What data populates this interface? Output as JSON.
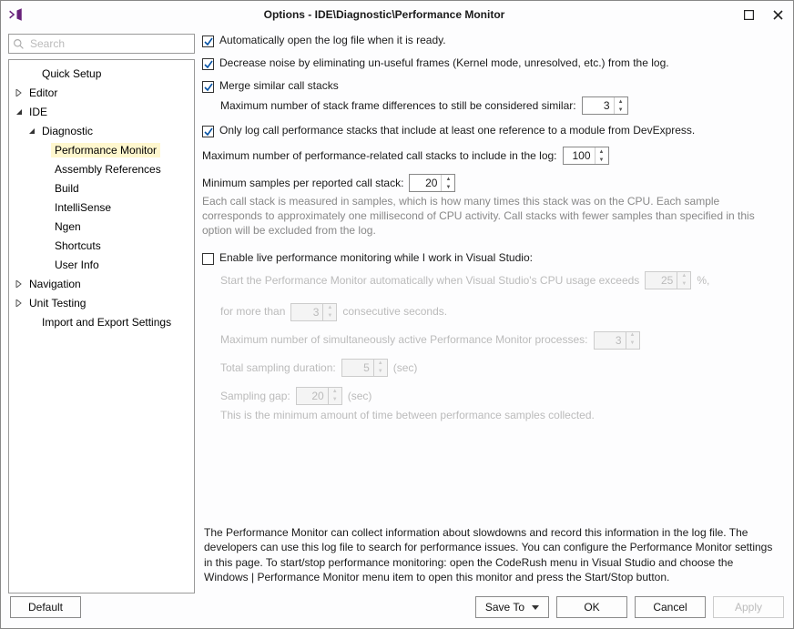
{
  "window": {
    "title": "Options - IDE\\Diagnostic\\Performance Monitor"
  },
  "search": {
    "placeholder": "Search"
  },
  "tree": {
    "quick_setup": "Quick Setup",
    "editor": "Editor",
    "ide": "IDE",
    "diagnostic": "Diagnostic",
    "performance_monitor": "Performance Monitor",
    "assembly_references": "Assembly References",
    "build": "Build",
    "intellisense": "IntelliSense",
    "ngen": "Ngen",
    "shortcuts": "Shortcuts",
    "user_info": "User Info",
    "navigation": "Navigation",
    "unit_testing": "Unit Testing",
    "import_export": "Import and Export Settings"
  },
  "opts": {
    "auto_open": "Automatically open the log file when it is ready.",
    "decrease_noise": "Decrease noise by eliminating un-useful frames (Kernel mode, unresolved, etc.) from the log.",
    "merge_stacks": "Merge similar call stacks",
    "max_diff_label": "Maximum number of stack frame differences to still be considered similar:",
    "max_diff_value": "3",
    "only_devexpress": "Only log call performance stacks that include at least one reference to a module from DevExpress.",
    "max_stacks_label": "Maximum number of performance-related call stacks to include in the log:",
    "max_stacks_value": "100",
    "min_samples_label": "Minimum samples per reported call stack:",
    "min_samples_value": "20",
    "min_samples_hint": "Each call stack is measured in samples, which is how many times this stack was on the CPU. Each sample corresponds to approximately one millisecond of CPU activity. Call stacks with fewer samples than specified in this option will be excluded from the log.",
    "enable_live": "Enable live performance monitoring while I work in Visual Studio:",
    "live_start_pre": "Start the Performance Monitor automatically when Visual Studio's CPU usage exceeds",
    "live_start_pct": "25",
    "live_start_pctunit": "%,",
    "live_start_mid": "for more than",
    "live_start_sec": "3",
    "live_start_post": "consecutive seconds.",
    "live_maxproc_label": "Maximum number of simultaneously active Performance Monitor processes:",
    "live_maxproc_value": "3",
    "live_total_label": "Total sampling duration:",
    "live_total_value": "5",
    "sec_unit": "(sec)",
    "live_gap_label": "Sampling gap:",
    "live_gap_value": "20",
    "live_gap_hint": "This is the minimum amount of time between performance samples collected.",
    "description": "The Performance Monitor can collect information about slowdowns and record this information in the log file. The developers can use this log file to search for performance issues. You can configure the Performance Monitor settings in this page. To start/stop performance monitoring: open the CodeRush menu in Visual Studio and choose the Windows | Performance Monitor menu item to open this monitor and press the Start/Stop button."
  },
  "footer": {
    "default": "Default",
    "save_to": "Save To",
    "ok": "OK",
    "cancel": "Cancel",
    "apply": "Apply"
  }
}
